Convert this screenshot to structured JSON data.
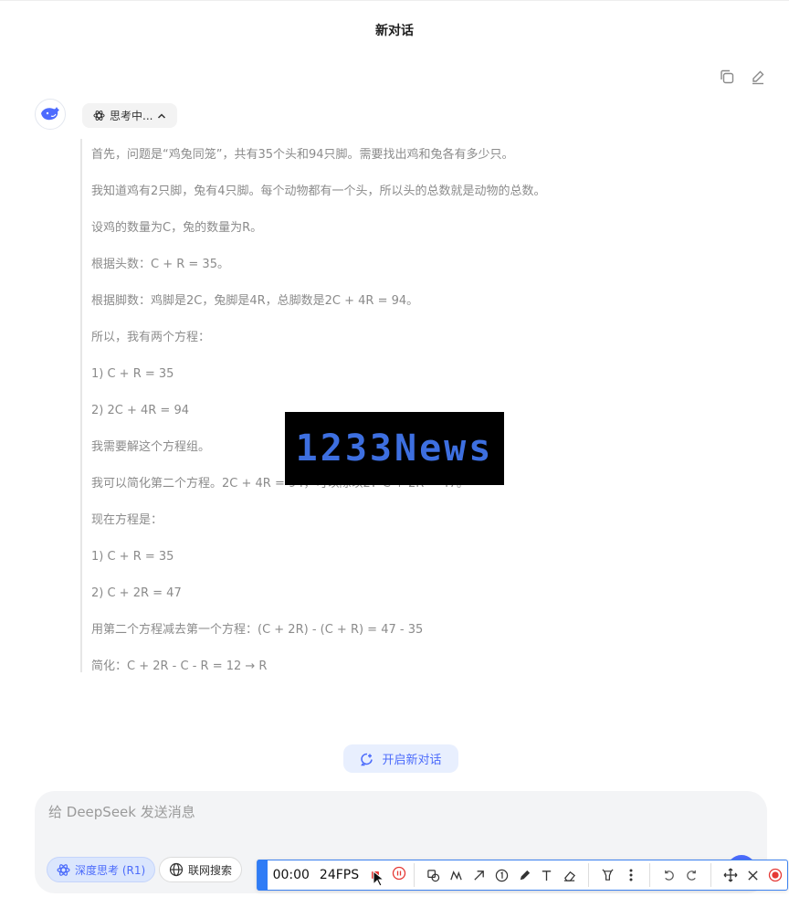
{
  "header": {
    "title": "新对话"
  },
  "thinking": {
    "status_label": "思考中...",
    "lines": [
      "首先，问题是“鸡兔同笼”，共有35个头和94只脚。需要找出鸡和兔各有多少只。",
      "我知道鸡有2只脚，兔有4只脚。每个动物都有一个头，所以头的总数就是动物的总数。",
      "设鸡的数量为C，兔的数量为R。",
      "根据头数：C + R = 35。",
      "根据脚数：鸡脚是2C，兔脚是4R，总脚数是2C + 4R = 94。",
      "所以，我有两个方程：",
      "1) C + R = 35",
      "2) 2C + 4R = 94",
      "我需要解这个方程组。",
      "我可以简化第二个方程。2C + 4R = 94，可以除以2：C + 2R = 47。",
      "现在方程是：",
      "1) C + R = 35",
      "2) C + 2R = 47",
      "用第二个方程减去第一个方程：(C + 2R) - (C + R) = 47 - 35",
      "简化：C + 2R - C - R = 12 → R"
    ]
  },
  "watermark": {
    "text": "1233News"
  },
  "new_chat": {
    "label": "开启新对话"
  },
  "composer": {
    "placeholder": "给 DeepSeek 发送消息",
    "deep_think_label": "深度思考 (R1)",
    "web_search_label": "联网搜索"
  },
  "recorder": {
    "time": "00:00",
    "fps": "24FPS"
  },
  "colors": {
    "accent": "#4b6bfb",
    "chip_bg": "#dbe6fd",
    "recorder_blue": "#2f7cf6",
    "record_red": "#e53935"
  }
}
